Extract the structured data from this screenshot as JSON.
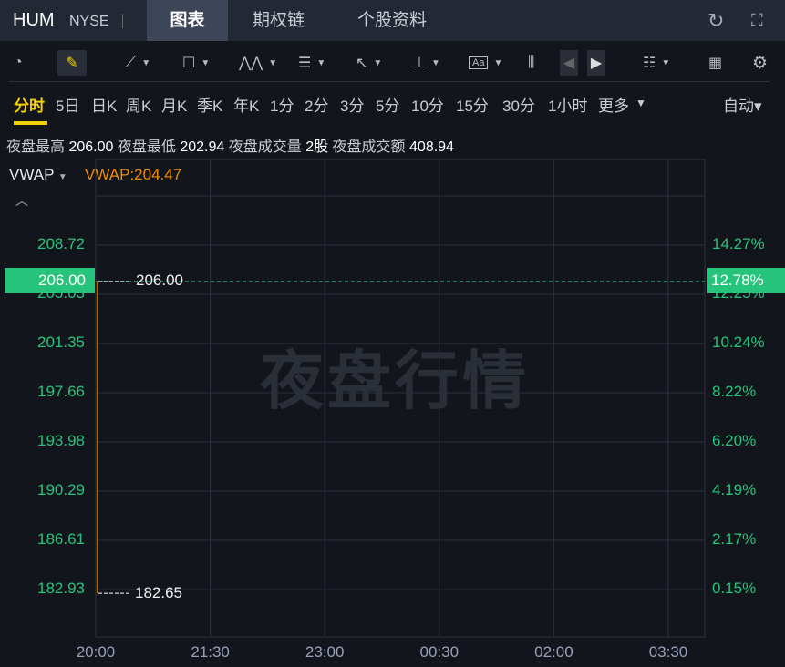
{
  "header": {
    "symbol": "HUM",
    "exchange": "NYSE",
    "tabs": [
      "图表",
      "期权链",
      "个股资料"
    ],
    "active_tab": 0
  },
  "toolbar": {
    "icons": [
      "gauge-icon",
      "pencil-icon",
      "line-icon",
      "rectangle-icon",
      "pattern-icon",
      "fib-icon",
      "arrow-icon",
      "measure-icon",
      "text-icon",
      "candle-icon",
      "prev-icon",
      "next-icon",
      "layout-list-icon",
      "grid-icon",
      "settings-icon"
    ]
  },
  "periods": [
    "分时",
    "5日",
    "日K",
    "周K",
    "月K",
    "季K",
    "年K",
    "1分",
    "2分",
    "3分",
    "5分",
    "10分",
    "15分",
    "30分",
    "1小时",
    "更多"
  ],
  "more_caret": "▼",
  "auto_label": "自动▾",
  "stats": {
    "high_label": "夜盘最高",
    "high": "206.00",
    "low_label": "夜盘最低",
    "low": "202.94",
    "vol_label": "夜盘成交量",
    "vol": "2股",
    "amt_label": "夜盘成交额",
    "amt": "408.94"
  },
  "indicator": {
    "name": "VWAP",
    "value_text": "VWAP:204.47"
  },
  "watermark": "夜盘行情",
  "chart_data": {
    "type": "line",
    "y_left_ticks": [
      "208.72",
      "205.03",
      "201.35",
      "197.66",
      "193.98",
      "190.29",
      "186.61",
      "182.93"
    ],
    "y_right_ticks": [
      "14.27%",
      "12.25%",
      "10.24%",
      "8.22%",
      "6.20%",
      "4.19%",
      "2.17%",
      "0.15%"
    ],
    "x_ticks": [
      "20:00",
      "21:30",
      "23:00",
      "00:30",
      "02:00",
      "03:30"
    ],
    "current_price": "206.00",
    "current_pct": "12.78%",
    "high_label": "206.00",
    "low_label": "182.65",
    "ylim": [
      182.93,
      208.72
    ],
    "series": [
      {
        "name": "price",
        "x": [
          "20:00",
          "20:00"
        ],
        "values": [
          182.65,
          206.0
        ],
        "color": "#f08c00"
      }
    ]
  }
}
